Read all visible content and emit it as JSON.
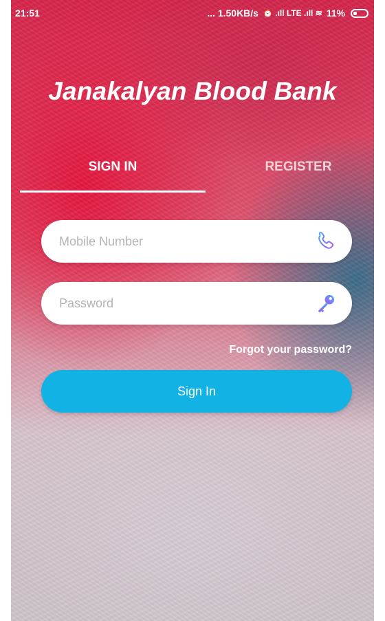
{
  "status_bar": {
    "time": "21:51",
    "network_speed": "... 1.50KB/s",
    "indicators": "⏰ .ıll LTE .ıll ≋",
    "battery": "11%"
  },
  "app": {
    "title": "Janakalyan Blood Bank"
  },
  "tabs": [
    {
      "label": "SIGN IN",
      "active": true
    },
    {
      "label": "REGISTER",
      "active": false
    }
  ],
  "form": {
    "mobile_placeholder": "Mobile Number",
    "mobile_icon": "phone-icon",
    "password_placeholder": "Password",
    "password_icon": "key-icon",
    "forgot_label": "Forgot your password?",
    "submit_label": "Sign In"
  },
  "colors": {
    "primary_button": "#12b3e4",
    "icon_gradient_start": "#4aa8f5",
    "icon_gradient_end": "#a75bf0"
  }
}
